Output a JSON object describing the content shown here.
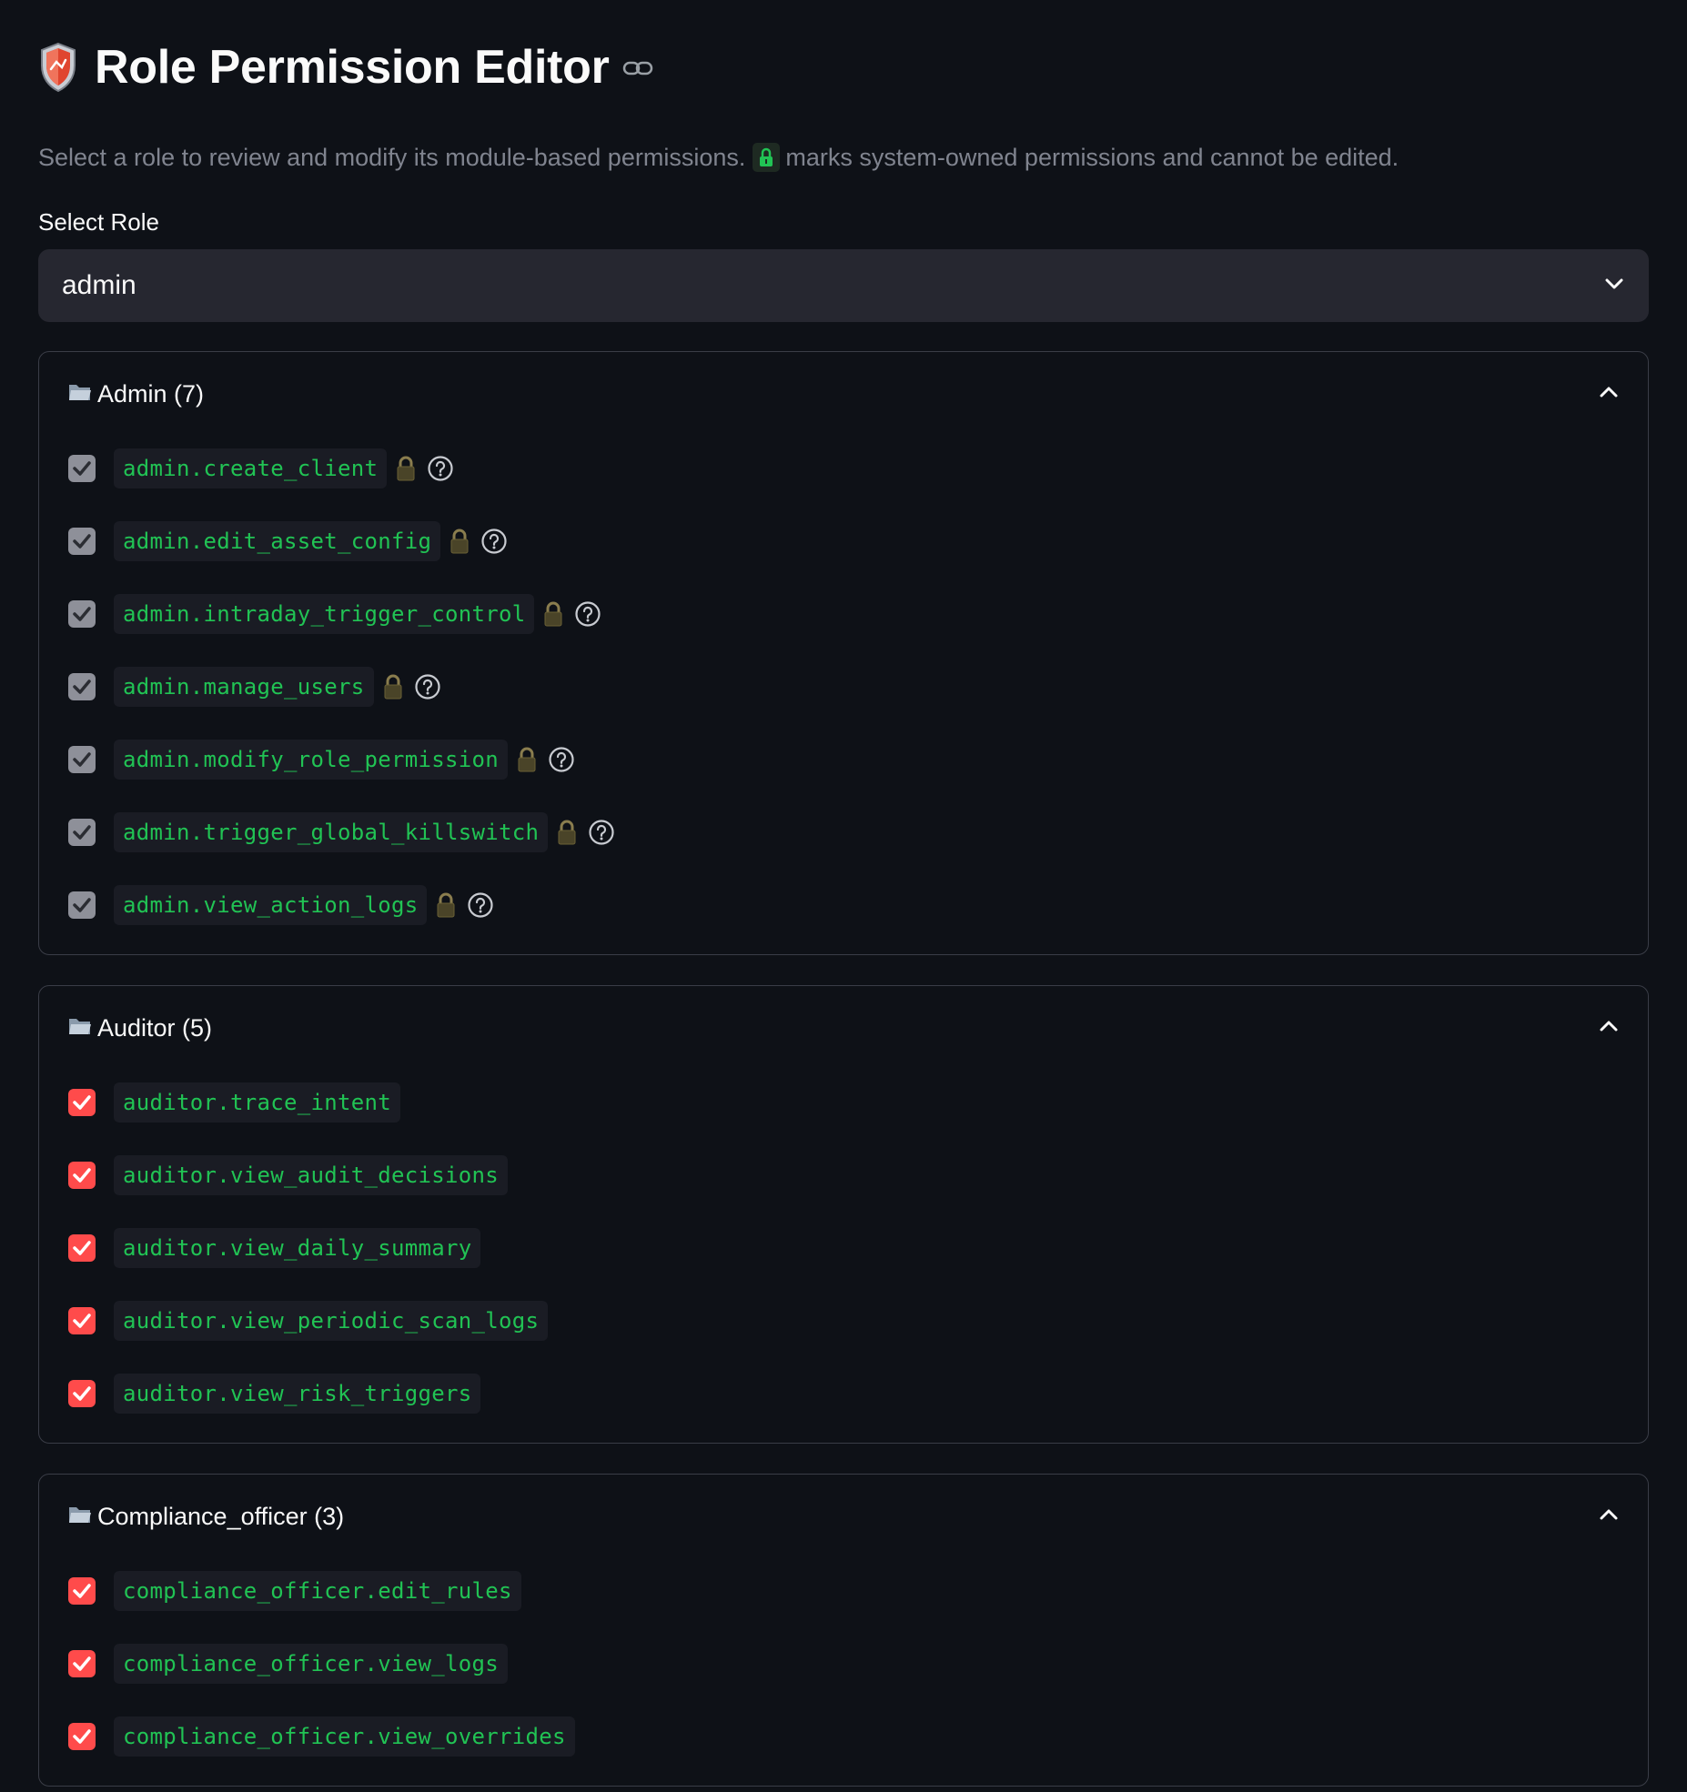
{
  "header": {
    "title": "Role Permission Editor",
    "subtitle_before": "Select a role to review and modify its module-based permissions.",
    "subtitle_after": "marks system-owned permissions and cannot be edited."
  },
  "role_select": {
    "label": "Select Role",
    "value": "admin"
  },
  "colors": {
    "background": "#0e1117",
    "accent": "#ff4b4b",
    "code_green": "#21c354",
    "disabled_checkbox": "#8e9099"
  },
  "icons": {
    "header": "shield-icon",
    "anchor": "link-icon",
    "group": "folder-icon",
    "locked": "lock-icon",
    "help": "question-circle-icon",
    "collapse": "chevron-up-icon",
    "dropdown": "chevron-down-icon"
  },
  "groups": [
    {
      "title": "Admin (7)",
      "permissions": [
        {
          "name": "admin.create_client",
          "checked": true,
          "locked": true
        },
        {
          "name": "admin.edit_asset_config",
          "checked": true,
          "locked": true
        },
        {
          "name": "admin.intraday_trigger_control",
          "checked": true,
          "locked": true
        },
        {
          "name": "admin.manage_users",
          "checked": true,
          "locked": true
        },
        {
          "name": "admin.modify_role_permission",
          "checked": true,
          "locked": true
        },
        {
          "name": "admin.trigger_global_killswitch",
          "checked": true,
          "locked": true
        },
        {
          "name": "admin.view_action_logs",
          "checked": true,
          "locked": true
        }
      ]
    },
    {
      "title": "Auditor (5)",
      "permissions": [
        {
          "name": "auditor.trace_intent",
          "checked": true,
          "locked": false
        },
        {
          "name": "auditor.view_audit_decisions",
          "checked": true,
          "locked": false
        },
        {
          "name": "auditor.view_daily_summary",
          "checked": true,
          "locked": false
        },
        {
          "name": "auditor.view_periodic_scan_logs",
          "checked": true,
          "locked": false
        },
        {
          "name": "auditor.view_risk_triggers",
          "checked": true,
          "locked": false
        }
      ]
    },
    {
      "title": "Compliance_officer (3)",
      "permissions": [
        {
          "name": "compliance_officer.edit_rules",
          "checked": true,
          "locked": false
        },
        {
          "name": "compliance_officer.view_logs",
          "checked": true,
          "locked": false
        },
        {
          "name": "compliance_officer.view_overrides",
          "checked": true,
          "locked": false
        }
      ]
    }
  ]
}
